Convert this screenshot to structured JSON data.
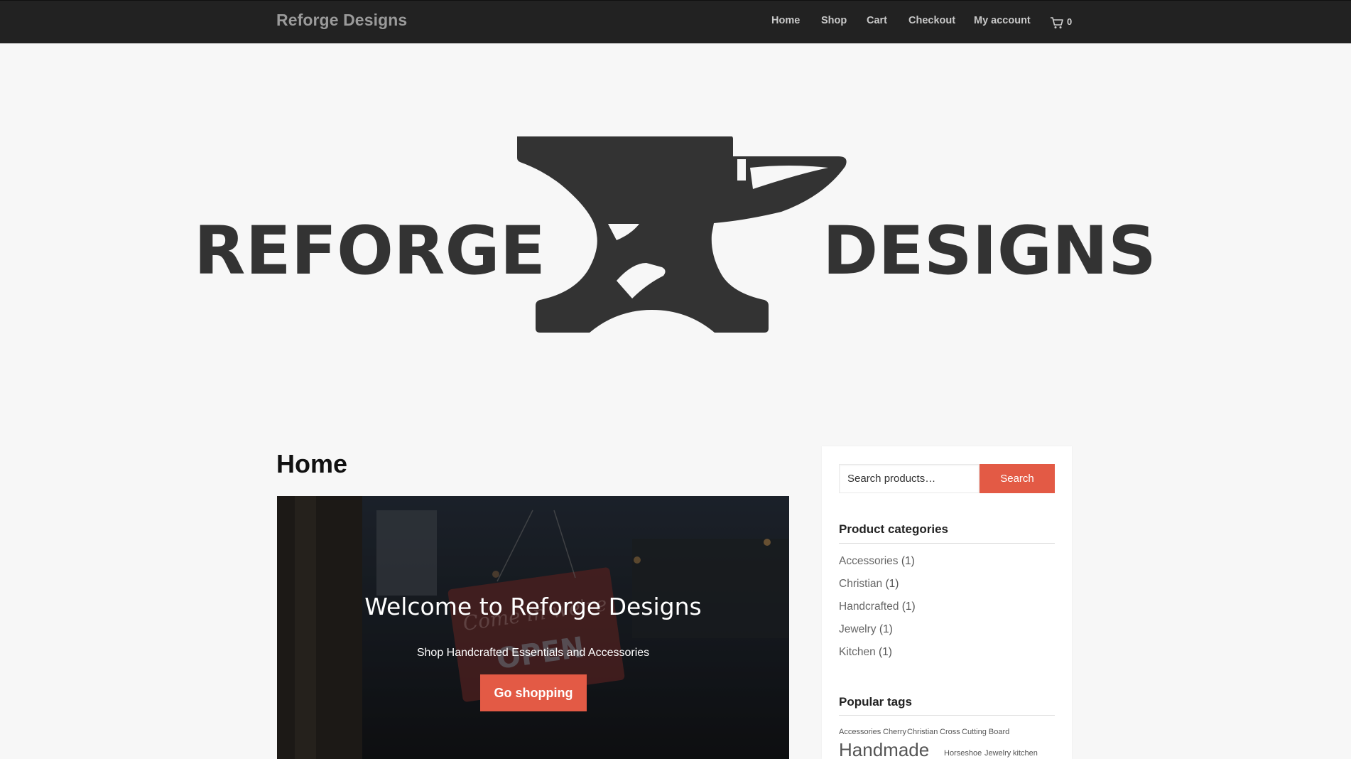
{
  "header": {
    "site_title": "Reforge Designs",
    "nav": [
      "Home",
      "Shop",
      "Cart",
      "Checkout",
      "My account"
    ],
    "cart_count": "0",
    "cart_icon": "cart-icon"
  },
  "hero": {
    "logo_left": "REFORGE",
    "logo_right": "DESIGNS",
    "logo_icon": "anvil-icon",
    "logo_color": "#333333"
  },
  "main": {
    "page_title": "Home",
    "banner": {
      "title": "Welcome to Reforge Designs",
      "subtitle": "Shop Handcrafted Essentials and Accessories",
      "button": "Go shopping",
      "sign_text_1": "Come in we're",
      "sign_text_2": "OPEN"
    }
  },
  "sidebar": {
    "search": {
      "placeholder": "Search products…",
      "button": "Search"
    },
    "categories": {
      "title": "Product categories",
      "items": [
        {
          "name": "Accessories",
          "count": "(1)"
        },
        {
          "name": "Christian",
          "count": "(1)"
        },
        {
          "name": "Handcrafted",
          "count": "(1)"
        },
        {
          "name": "Jewelry",
          "count": "(1)"
        },
        {
          "name": "Kitchen",
          "count": "(1)"
        }
      ]
    },
    "tags": {
      "title": "Popular tags",
      "items": [
        "Accessories",
        "Cherry",
        "Christian",
        "Cross",
        "Cutting Board",
        "Handmade",
        "Horseshoe",
        "Jewelry",
        "kitchen"
      ]
    }
  },
  "colors": {
    "accent": "#e35a45",
    "topbar": "#222222",
    "background": "#f7f7f7"
  }
}
